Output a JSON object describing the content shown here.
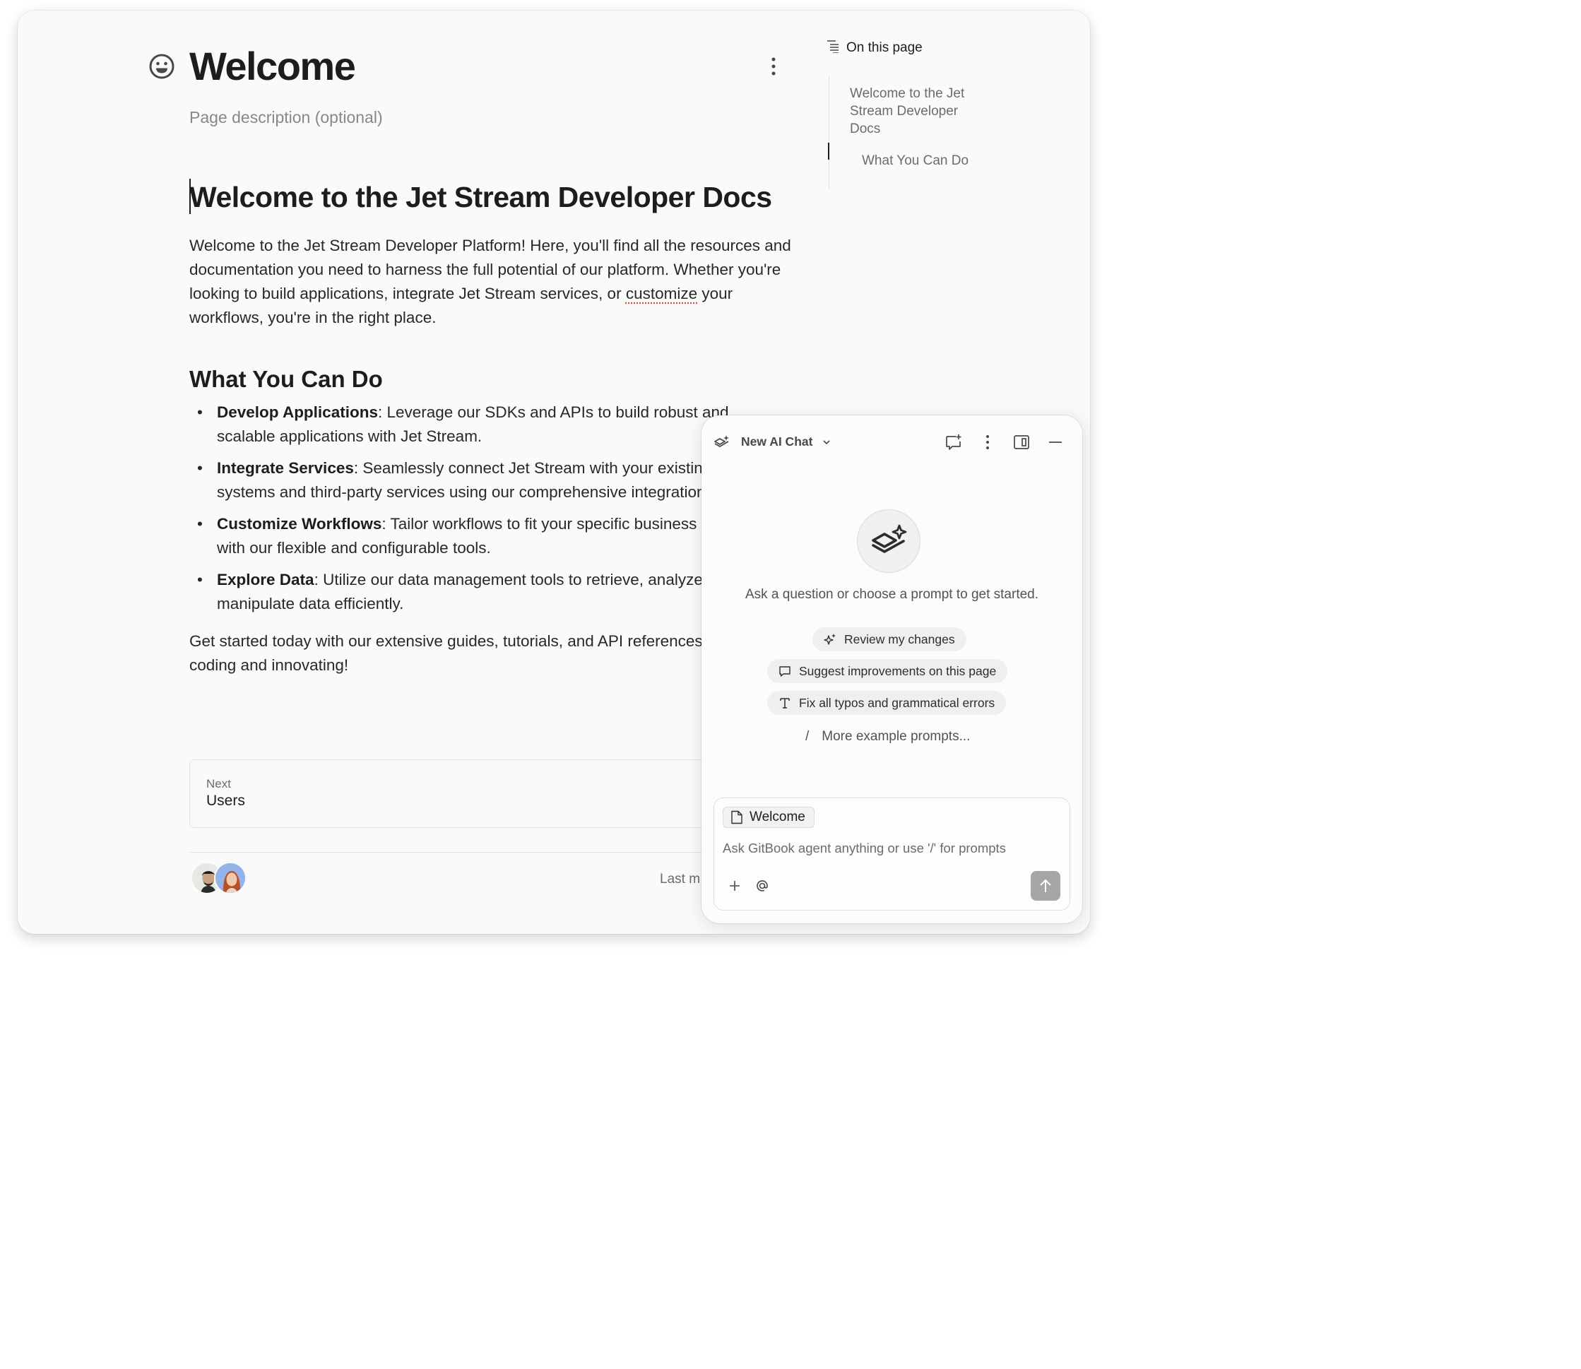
{
  "page": {
    "title": "Welcome",
    "description_placeholder": "Page description (optional)"
  },
  "article": {
    "h1": "Welcome to the Jet Stream Developer Docs",
    "intro_before": "Welcome to the Jet Stream Developer Platform! Here, you'll find all the resources and documentation you need to harness the full potential of our platform. Whether you're looking to build applications, integrate Jet Stream services, or ",
    "intro_flagged": "customize",
    "intro_after": " your workflows, you're in the right place.",
    "h2": "What You Can Do",
    "bullets": [
      {
        "bold": "Develop Applications",
        "text": ": Leverage our SDKs and APIs to build robust and scalable applications with Jet Stream."
      },
      {
        "bold": "Integrate Services",
        "text": ": Seamlessly connect Jet Stream with your existing systems and third-party services using our comprehensive integration guides."
      },
      {
        "bold": "Customize Workflows",
        "text": ": Tailor workflows to fit your specific business needs with our flexible and configurable tools."
      },
      {
        "bold": "Explore Data",
        "text": ": Utilize our data management tools to retrieve, analyze, and manipulate data efficiently."
      }
    ],
    "outro": "Get started today with our extensive guides, tutorials, and API references to start coding and innovating!"
  },
  "next": {
    "label": "Next",
    "title": "Users"
  },
  "footer": {
    "last_modified_prefix": "Last m"
  },
  "toc": {
    "heading": "On this page",
    "items": [
      {
        "line1": "Welcome to the Jet",
        "line2": "Stream Developer",
        "line3": "Docs"
      },
      {
        "line1": "What You Can Do"
      }
    ]
  },
  "chat": {
    "title": "New AI Chat",
    "hint": "Ask a question or choose a prompt to get started.",
    "prompts": [
      {
        "icon": "sparkle-icon",
        "label": "Review my changes"
      },
      {
        "icon": "comment-icon",
        "label": "Suggest improvements on this page"
      },
      {
        "icon": "text-type-icon",
        "label": "Fix all typos and grammatical errors"
      }
    ],
    "more_prompts": "More example prompts...",
    "slash": "/",
    "context_chip": "Welcome",
    "input_placeholder": "Ask GitBook agent anything or use '/' for prompts"
  },
  "colors": {
    "background": "#fafafa",
    "text": "#1f1d1b",
    "muted": "#6e6b68",
    "send_button": "#a8a6a4",
    "spellcheck": "#d24b4b"
  }
}
